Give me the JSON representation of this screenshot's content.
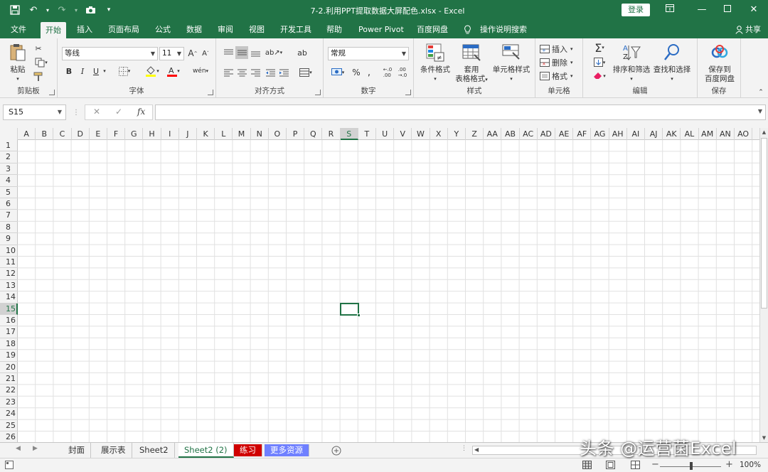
{
  "window": {
    "title": "7-2.利用PPT提取数据大屏配色.xlsx  -  Excel",
    "login_label": "登录",
    "share_label": "共享"
  },
  "tabs": [
    {
      "id": "file",
      "label": "文件"
    },
    {
      "id": "home",
      "label": "开始"
    },
    {
      "id": "insert",
      "label": "插入"
    },
    {
      "id": "layout",
      "label": "页面布局"
    },
    {
      "id": "formulas",
      "label": "公式"
    },
    {
      "id": "data",
      "label": "数据"
    },
    {
      "id": "review",
      "label": "审阅"
    },
    {
      "id": "view",
      "label": "视图"
    },
    {
      "id": "developer",
      "label": "开发工具"
    },
    {
      "id": "help",
      "label": "帮助"
    },
    {
      "id": "powerpivot",
      "label": "Power Pivot"
    },
    {
      "id": "baidu",
      "label": "百度网盘"
    },
    {
      "id": "tellme",
      "label": "操作说明搜索"
    }
  ],
  "ribbon": {
    "clipboard": {
      "label": "剪贴板",
      "paste": "粘贴"
    },
    "font": {
      "label": "字体",
      "font_name": "等线",
      "font_size": "11",
      "bold": "B",
      "italic": "I",
      "underline": "U"
    },
    "alignment": {
      "label": "对齐方式"
    },
    "number": {
      "label": "数字",
      "format": "常规",
      "percent": "%"
    },
    "styles": {
      "label": "样式",
      "conditional": "条件格式",
      "table_line1": "套用",
      "table_line2": "表格格式",
      "cell_styles": "单元格样式"
    },
    "cells": {
      "label": "单元格",
      "insert": "插入",
      "delete": "删除",
      "format": "格式"
    },
    "editing": {
      "label": "编辑",
      "sort": "排序和筛选",
      "find": "查找和选择"
    },
    "save": {
      "label": "保存",
      "line1": "保存到",
      "line2": "百度网盘"
    }
  },
  "formula_bar": {
    "name_box": "S15",
    "fx": "fx",
    "cancel": "✕",
    "confirm": "✓",
    "formula": ""
  },
  "grid": {
    "columns": [
      "A",
      "B",
      "C",
      "D",
      "E",
      "F",
      "G",
      "H",
      "I",
      "J",
      "K",
      "L",
      "M",
      "N",
      "O",
      "P",
      "Q",
      "R",
      "S",
      "T",
      "U",
      "V",
      "W",
      "X",
      "Y",
      "Z",
      "AA",
      "AB",
      "AC",
      "AD",
      "AE",
      "AF",
      "AG",
      "AH",
      "AI",
      "AJ",
      "AK",
      "AL",
      "AM",
      "AN",
      "AO"
    ],
    "rows": [
      "1",
      "2",
      "3",
      "4",
      "5",
      "6",
      "7",
      "8",
      "9",
      "10",
      "11",
      "12",
      "13",
      "14",
      "15",
      "16",
      "17",
      "18",
      "19",
      "20",
      "21",
      "22",
      "23",
      "24",
      "25",
      "26"
    ],
    "selected_column": "S",
    "selected_row": "15"
  },
  "sheets": [
    {
      "name": "封面",
      "style": "normal"
    },
    {
      "name": "展示表",
      "style": "normal"
    },
    {
      "name": "Sheet2",
      "style": "normal"
    },
    {
      "name": "Sheet2 (2)",
      "style": "active"
    },
    {
      "name": "练习",
      "style": "red"
    },
    {
      "name": "更多资源",
      "style": "blue"
    }
  ],
  "status": {
    "zoom": "100%",
    "zoom_minus": "−",
    "zoom_plus": "+"
  },
  "watermark": "头条 @运营菌Excel",
  "colors": {
    "accent": "#217346",
    "red_tab": "#d00000",
    "blue_tab": "#6f80ff"
  }
}
